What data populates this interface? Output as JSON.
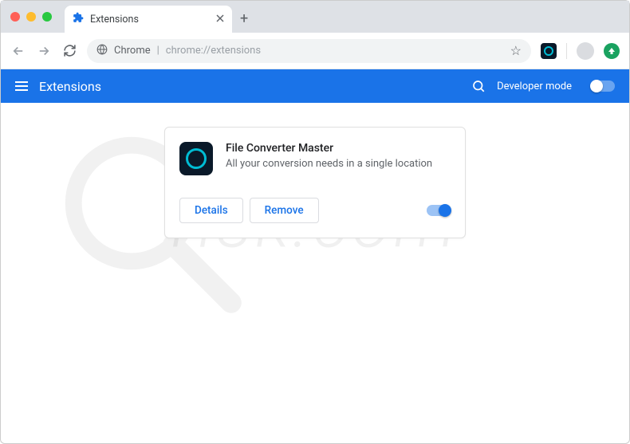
{
  "window": {
    "tab_title": "Extensions",
    "omnibox_context": "Chrome",
    "omnibox_url": "chrome://extensions"
  },
  "page_header": {
    "title": "Extensions",
    "developer_mode_label": "Developer mode"
  },
  "extension_card": {
    "name": "File Converter Master",
    "description": "All your conversion needs in a single location",
    "details_label": "Details",
    "remove_label": "Remove",
    "enabled": true
  },
  "colors": {
    "accent": "#1a73e8",
    "secondary_text": "#5f6368"
  }
}
